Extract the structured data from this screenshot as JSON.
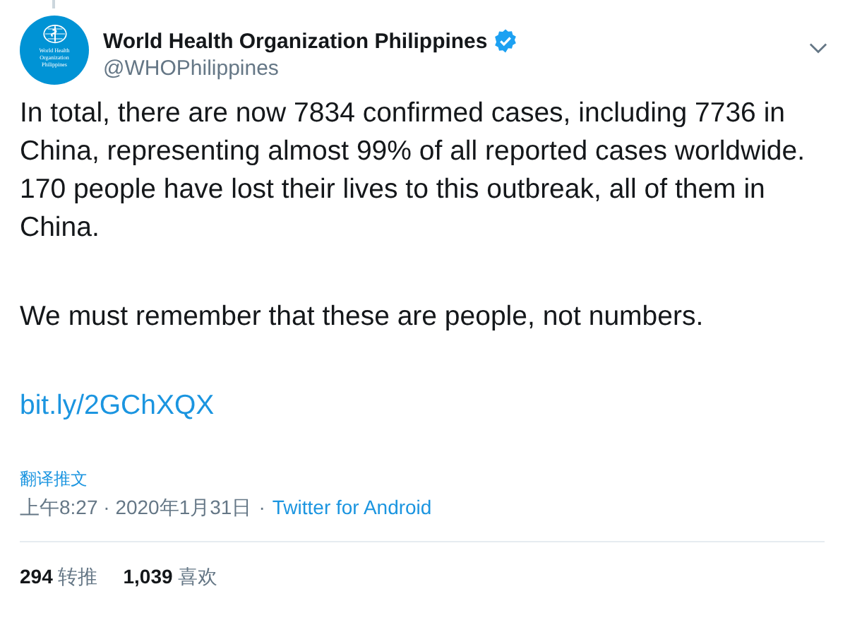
{
  "tweet": {
    "avatar": {
      "logo_lines": [
        "World Health",
        "Organization",
        "Philippines"
      ]
    },
    "author": {
      "name": "World Health Organization Philippines",
      "verified": true,
      "handle": "@WHOPhilippines"
    },
    "paragraphs": [
      "In total, there are now 7834 confirmed cases, including 7736 in China, representing almost 99% of all reported cases worldwide. 170 people have lost their lives to this outbreak, all of them in China.",
      "We must remember that these are people, not numbers."
    ],
    "link": "bit.ly/2GChXQX",
    "translate": "翻译推文",
    "timestamp": "上午8:27 · 2020年1月31日",
    "separator": "·",
    "source": "Twitter for Android",
    "stats": [
      {
        "count": "294",
        "label": "转推"
      },
      {
        "count": "1,039",
        "label": "喜欢"
      }
    ]
  }
}
